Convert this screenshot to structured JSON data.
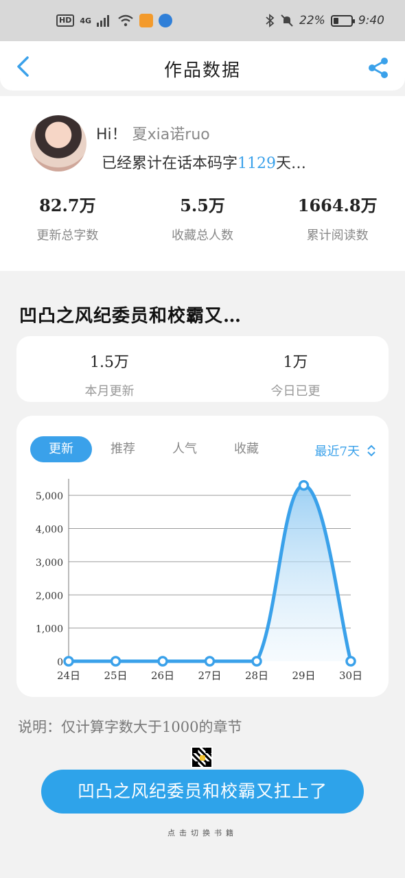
{
  "status_bar": {
    "hd": "HD",
    "network": "4G",
    "battery": "22%",
    "time": "9:40"
  },
  "header": {
    "title": "作品数据",
    "back_icon": "chevron-left-icon",
    "share_icon": "share-icon"
  },
  "profile": {
    "greeting": "Hi！",
    "name": "夏xia诺ruo",
    "days_prefix": "已经累计在话本码字",
    "days_value": "1129",
    "days_suffix": "天…"
  },
  "stats": [
    {
      "value": "82.7万",
      "label": "更新总字数"
    },
    {
      "value": "5.5万",
      "label": "收藏总人数"
    },
    {
      "value": "1664.8万",
      "label": "累计阅读数"
    }
  ],
  "book": {
    "title": "凹凸之风纪委员和校霸又…"
  },
  "month_stats": [
    {
      "value": "1.5万",
      "label": "本月更新"
    },
    {
      "value": "1万",
      "label": "今日已更"
    }
  ],
  "chart": {
    "tabs": [
      "更新",
      "推荐",
      "人气",
      "收藏"
    ],
    "active_tab": 0,
    "range_label": "最近7天",
    "accent": "#3aa1ea"
  },
  "chart_data": {
    "type": "area",
    "categories": [
      "24日",
      "25日",
      "26日",
      "27日",
      "28日",
      "29日",
      "30日"
    ],
    "values": [
      0,
      0,
      0,
      0,
      0,
      5300,
      0
    ],
    "y_ticks": [
      "0",
      "1,000",
      "2,000",
      "3,000",
      "4,000",
      "5,000"
    ],
    "ylim": [
      0,
      5500
    ],
    "grid": true
  },
  "note": "说明：仅计算字数大于1000的章节",
  "cta_label": "凹凸之风纪委员和校霸又扛上了",
  "bottom_hint": "点击切换书籍"
}
